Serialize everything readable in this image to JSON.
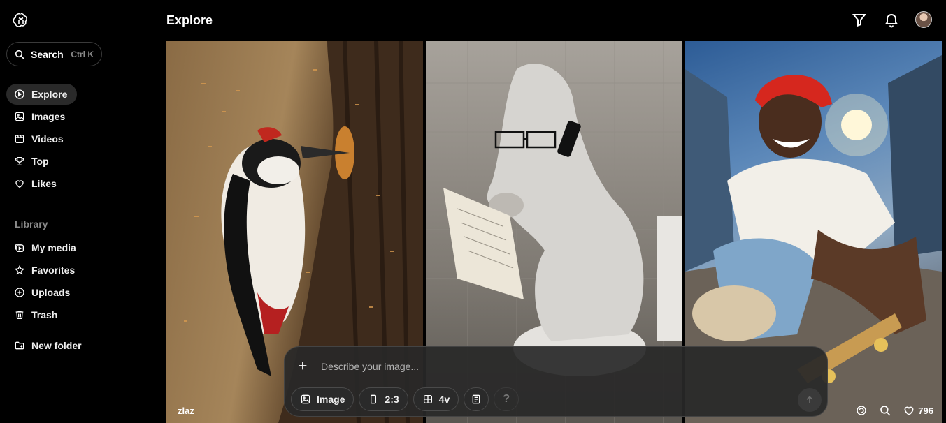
{
  "sidebar": {
    "search_label": "Search",
    "search_shortcut": "Ctrl K",
    "main_items": [
      {
        "label": "Explore",
        "icon": "compass-icon",
        "active": true
      },
      {
        "label": "Images",
        "icon": "image-icon"
      },
      {
        "label": "Videos",
        "icon": "video-icon"
      },
      {
        "label": "Top",
        "icon": "trophy-icon"
      },
      {
        "label": "Likes",
        "icon": "heart-icon"
      }
    ],
    "library_label": "Library",
    "library_items": [
      {
        "label": "My media",
        "icon": "media-icon"
      },
      {
        "label": "Favorites",
        "icon": "star-icon"
      },
      {
        "label": "Uploads",
        "icon": "upload-icon"
      },
      {
        "label": "Trash",
        "icon": "trash-icon"
      }
    ],
    "new_folder_label": "New folder"
  },
  "header": {
    "title": "Explore"
  },
  "gallery": {
    "items": [
      {
        "subject": "woodpecker",
        "author": "zlaz"
      },
      {
        "subject": "horse-on-phone"
      },
      {
        "subject": "skateboarder",
        "likes": "796"
      }
    ]
  },
  "composer": {
    "placeholder": "Describe your image...",
    "type_label": "Image",
    "ratio_label": "2:3",
    "variations_label": "4v",
    "help_label": "?"
  },
  "colors": {
    "background": "#000000",
    "panel": "#282828",
    "active_nav": "#2a2a2a"
  }
}
